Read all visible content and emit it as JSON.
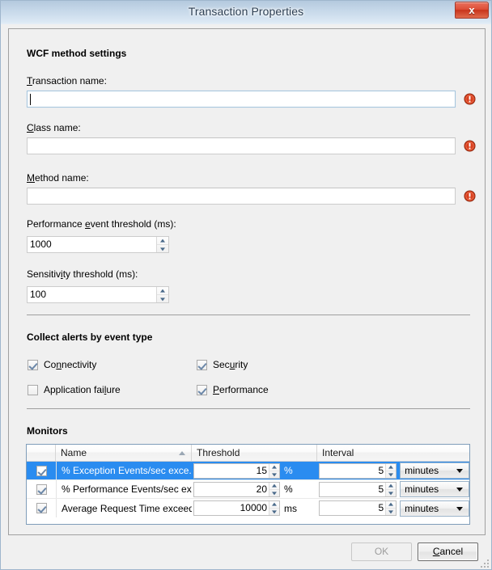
{
  "window": {
    "title": "Transaction Properties",
    "close_label": "x",
    "close_icon": "close-icon"
  },
  "sections": {
    "wcf": {
      "title": "WCF method settings",
      "fields": [
        {
          "label_pre": "",
          "label_mn": "T",
          "label_post": "ransaction name:",
          "value": "",
          "error": true,
          "focused": true
        },
        {
          "label_pre": "",
          "label_mn": "C",
          "label_post": "lass name:",
          "value": "",
          "error": true,
          "focused": false
        },
        {
          "label_pre": "",
          "label_mn": "M",
          "label_post": "ethod name:",
          "value": "",
          "error": true,
          "focused": false
        }
      ],
      "spinners": [
        {
          "label_pre": "Performance ",
          "label_mn": "e",
          "label_post": "vent threshold (ms):",
          "value": "1000"
        },
        {
          "label_pre": "Sensitiv",
          "label_mn": "i",
          "label_post": "ty threshold (ms):",
          "value": "100"
        }
      ]
    },
    "alerts": {
      "title": "Collect alerts by event type",
      "checkboxes": [
        {
          "pre": "Co",
          "mn": "n",
          "post": "nectivity",
          "checked": true,
          "col": 0,
          "row": 0
        },
        {
          "pre": "Sec",
          "mn": "u",
          "post": "rity",
          "checked": true,
          "col": 1,
          "row": 0
        },
        {
          "pre": "Application fai",
          "mn": "l",
          "post": "ure",
          "checked": false,
          "col": 0,
          "row": 1
        },
        {
          "pre": "",
          "mn": "P",
          "post": "erformance",
          "checked": true,
          "col": 1,
          "row": 1
        }
      ]
    },
    "monitors": {
      "title": "Monitors",
      "columns": [
        "",
        "Name",
        "Threshold",
        "Interval"
      ],
      "sort_column": "Name",
      "sort_direction": "ascending",
      "rows": [
        {
          "checked": true,
          "selected": true,
          "name": "% Exception Events/sec exce...",
          "threshold": "15",
          "threshold_unit": "%",
          "interval": "5",
          "interval_unit": "minutes"
        },
        {
          "checked": true,
          "selected": false,
          "name": "% Performance Events/sec ex...",
          "threshold": "20",
          "threshold_unit": "%",
          "interval": "5",
          "interval_unit": "minutes"
        },
        {
          "checked": true,
          "selected": false,
          "name": "Average Request Time exceed...",
          "threshold": "10000",
          "threshold_unit": "ms",
          "interval": "5",
          "interval_unit": "minutes"
        }
      ]
    }
  },
  "footer": {
    "ok_label": "OK",
    "ok_enabled": false,
    "cancel_pre": "",
    "cancel_mn": "C",
    "cancel_post": "ancel",
    "cancel_label": "Cancel",
    "cancel_default": true
  },
  "colors": {
    "selection_blue": "#2a8cf0",
    "error_red": "#d9401f",
    "title_text": "#2b3e52",
    "close_red": "#de4f38"
  }
}
